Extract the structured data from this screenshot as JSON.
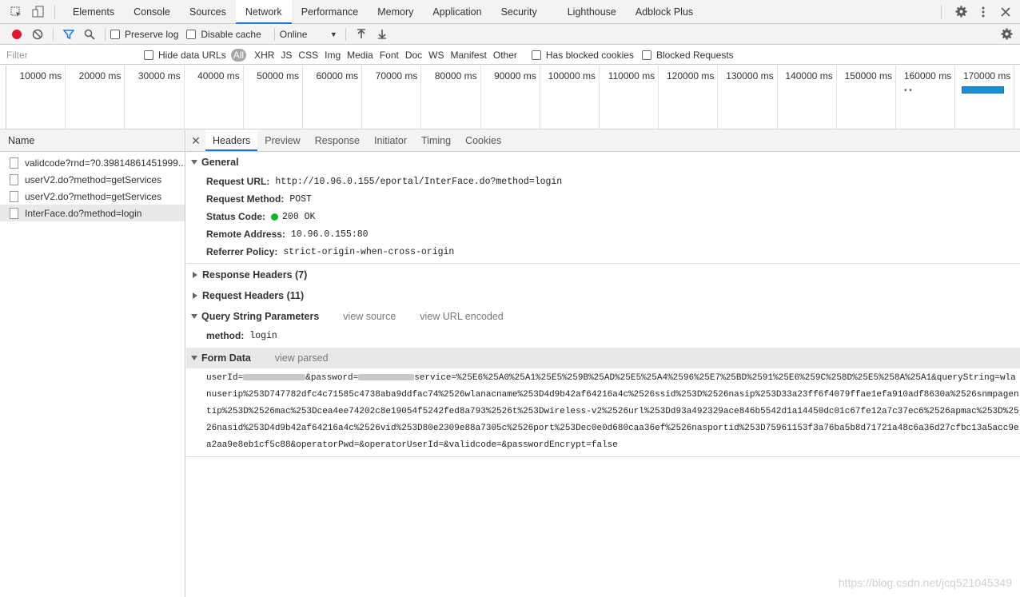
{
  "tabs": [
    "Elements",
    "Console",
    "Sources",
    "Network",
    "Performance",
    "Memory",
    "Application",
    "Security",
    "Lighthouse",
    "Adblock Plus"
  ],
  "active_tab": "Network",
  "toolbar": {
    "preserve_log": "Preserve log",
    "disable_cache": "Disable cache",
    "throttle": "Online"
  },
  "filter": {
    "placeholder": "Filter",
    "hide_data_urls": "Hide data URLs",
    "types": [
      "All",
      "XHR",
      "JS",
      "CSS",
      "Img",
      "Media",
      "Font",
      "Doc",
      "WS",
      "Manifest",
      "Other"
    ],
    "has_blocked_cookies": "Has blocked cookies",
    "blocked_requests": "Blocked Requests"
  },
  "overview": {
    "ticks": [
      "10000 ms",
      "20000 ms",
      "30000 ms",
      "40000 ms",
      "50000 ms",
      "60000 ms",
      "70000 ms",
      "80000 ms",
      "90000 ms",
      "100000 ms",
      "110000 ms",
      "120000 ms",
      "130000 ms",
      "140000 ms",
      "150000 ms",
      "160000 ms",
      "170000 ms"
    ],
    "bar_color": "#1a8fd8"
  },
  "name_column": {
    "header": "Name",
    "requests": [
      "validcode?rnd=?0.39814861451999...",
      "userV2.do?method=getServices",
      "userV2.do?method=getServices",
      "InterFace.do?method=login"
    ]
  },
  "detail_tabs": [
    "Headers",
    "Preview",
    "Response",
    "Initiator",
    "Timing",
    "Cookies"
  ],
  "general": {
    "title": "General",
    "request_url_label": "Request URL:",
    "request_url": "http://10.96.0.155/eportal/InterFace.do?method=login",
    "request_method_label": "Request Method:",
    "request_method": "POST",
    "status_code_label": "Status Code:",
    "status_code": "200 OK",
    "remote_address_label": "Remote Address:",
    "remote_address": "10.96.0.155:80",
    "referrer_policy_label": "Referrer Policy:",
    "referrer_policy": "strict-origin-when-cross-origin"
  },
  "response_headers": "Response Headers (7)",
  "request_headers": "Request Headers (11)",
  "query_string": {
    "title": "Query String Parameters",
    "view_source": "view source",
    "view_url_encoded": "view URL encoded",
    "param_key": "method:",
    "param_value": "login"
  },
  "form_data": {
    "title": "Form Data",
    "view_parsed": "view parsed",
    "line1_a": "userId=",
    "line1_b": "&password=",
    "line1_c": "service=%25E6%25A0%25A1%25E5%259B%25AD%25E5%25A4%2596%25E7%25BD%2591%25E6%259C%258D%25E5%258A%25A1&queryString=wla",
    "line2": "nuserip%253D747782dfc4c71585c4738aba9ddfac74%2526wlanacname%253D4d9b42af64216a4c%2526ssid%253D%2526nasip%253D33a23ff6f4079ffae1efa910adf8630a%2526snmpagen",
    "line3": "tip%253D%2526mac%253Dcea4ee74202c8e19054f5242fed8a793%2526t%253Dwireless-v2%2526url%253Dd93a492329ace846b5542d1a14450dc01c67fe12a7c37ec6%2526apmac%253D%25",
    "line4": "26nasid%253D4d9b42af64216a4c%2526vid%253D80e2309e88a7305c%2526port%253Dec0e0d680caa36ef%2526nasportid%253D75961153f3a76ba5b8d71721a48c6a36d27cfbc13a5acc9e",
    "line5": "a2aa9e8eb1cf5c88&operatorPwd=&operatorUserId=&validcode=&passwordEncrypt=false"
  },
  "watermark": "https://blog.csdn.net/jcq521045349"
}
